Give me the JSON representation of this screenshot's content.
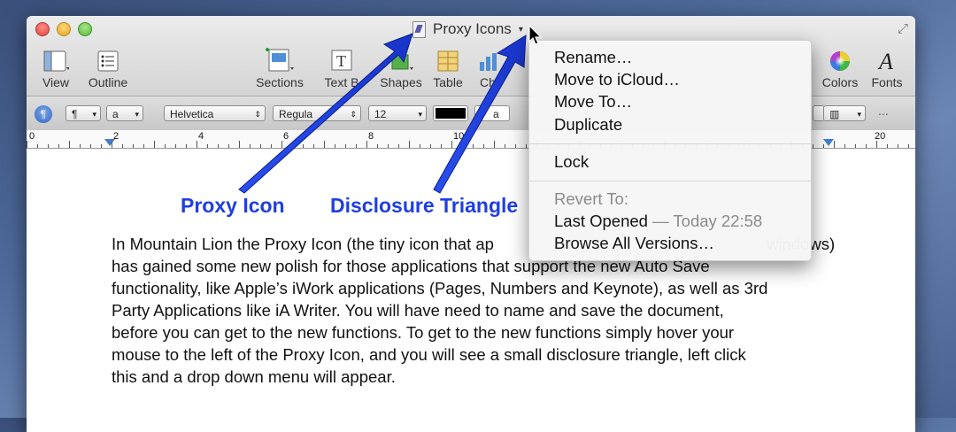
{
  "window": {
    "title": "Proxy Icons",
    "title_triangle": "▾",
    "fullscreen_glyph": "⤢"
  },
  "toolbar": {
    "items": [
      {
        "label": "View",
        "icon": "view-icon"
      },
      {
        "label": "Outline",
        "icon": "outline-icon"
      },
      {
        "label": "Sections",
        "icon": "sections-icon"
      },
      {
        "label": "Text B",
        "icon": "textbox-icon"
      },
      {
        "label": "Shapes",
        "icon": "shapes-icon"
      },
      {
        "label": "Table",
        "icon": "table-icon"
      },
      {
        "label": "Ch",
        "icon": "charts-icon"
      },
      {
        "label": "Colors",
        "icon": "colors-icon"
      },
      {
        "label": "Fonts",
        "icon": "fonts-icon"
      }
    ]
  },
  "format_bar": {
    "paragraph_symbol": "¶",
    "paragraph_style": "¶",
    "char_style": "a",
    "font_family": "Helvetica",
    "font_style": "Regula",
    "font_size": "12",
    "text_bg_label": "a",
    "more": "..."
  },
  "ruler": {
    "numbers": [
      "0",
      "2",
      "4",
      "6",
      "8",
      "10",
      "20"
    ]
  },
  "callouts": {
    "proxy_icon": "Proxy Icon",
    "disclosure_triangle": "Disclosure Triangle"
  },
  "body_lines": [
    "In Mountain Lion the Proxy Icon (the tiny icon that ap",
    "has gained some new polish for those applications that support the new Auto Save",
    "functionality, like Apple’s iWork applications (Pages, Numbers and Keynote), as well as 3rd",
    "Party Applications like iA Writer. You will have need to name and save the document,",
    "before you can get to the new functions. To get to the new functions simply hover your",
    "mouse to the left of the Proxy Icon, and you will see a small disclosure triangle, left click",
    "this and a drop down menu will appear."
  ],
  "body_trailing": "windows)",
  "menu": {
    "rename": "Rename…",
    "move_icloud": "Move to iCloud…",
    "move_to": "Move To…",
    "duplicate": "Duplicate",
    "lock": "Lock",
    "revert_to": "Revert To:",
    "last_opened": "Last Opened",
    "last_opened_time": "— Today 22:58",
    "browse_versions": "Browse All Versions…"
  },
  "colors": {
    "accent_arrow": "#1f3fe0",
    "callout_text": "#1f3fe0"
  }
}
